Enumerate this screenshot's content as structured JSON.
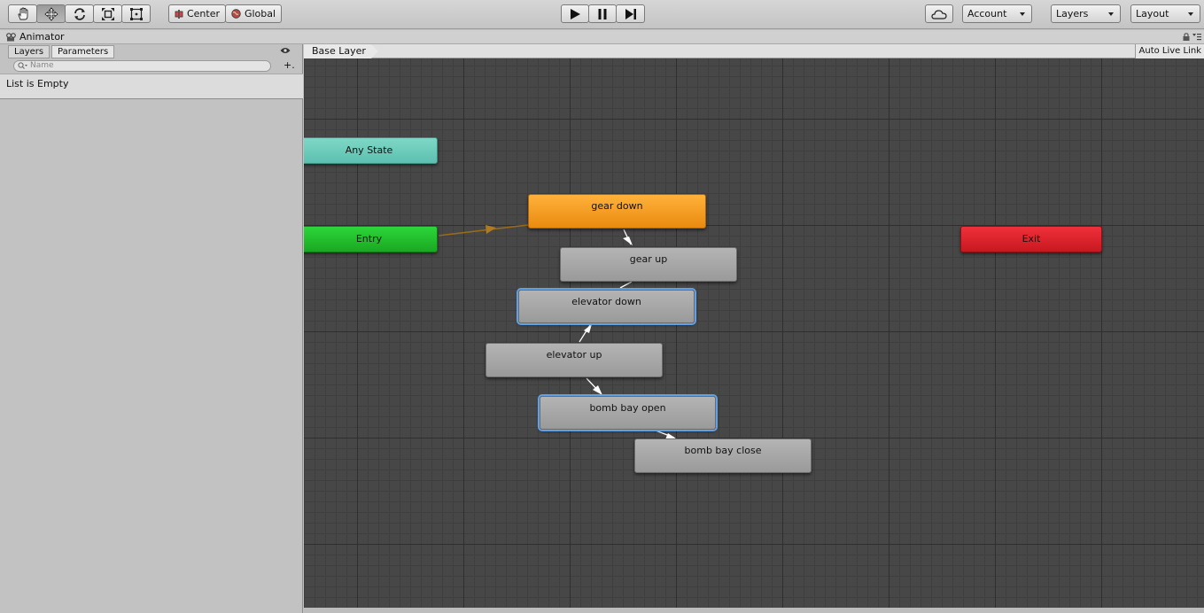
{
  "toolbar": {
    "tools": [
      "hand-tool",
      "move-tool",
      "rotate-tool",
      "scale-tool",
      "rect-tool"
    ],
    "pivot_label": "Center",
    "space_label": "Global",
    "account_label": "Account",
    "layers_label": "Layers",
    "layout_label": "Layout"
  },
  "window": {
    "title": "Animator"
  },
  "left_panel": {
    "tabs": [
      "Layers",
      "Parameters"
    ],
    "active_tab": "Parameters",
    "search_placeholder": "Name",
    "add_label": "+.",
    "empty_text": "List is Empty"
  },
  "graph": {
    "breadcrumb": "Base Layer",
    "live_link_label": "Auto Live Link",
    "states": {
      "any_state": "Any State",
      "entry": "Entry",
      "exit": "Exit",
      "gear_down": "gear down",
      "gear_up": "gear up",
      "elevator_down": "elevator down",
      "elevator_up": "elevator up",
      "bomb_bay_open": "bomb bay open",
      "bomb_bay_close": "bomb bay close"
    },
    "default_state": "gear down",
    "selected_states": [
      "elevator down",
      "bomb bay open"
    ],
    "colors": {
      "default_state": "#f39a22",
      "entry": "#22c02e",
      "exit": "#dc222b",
      "any_state": "#6ecbbb",
      "state": "#a8a8a8",
      "selection": "#5fa0e8"
    }
  }
}
